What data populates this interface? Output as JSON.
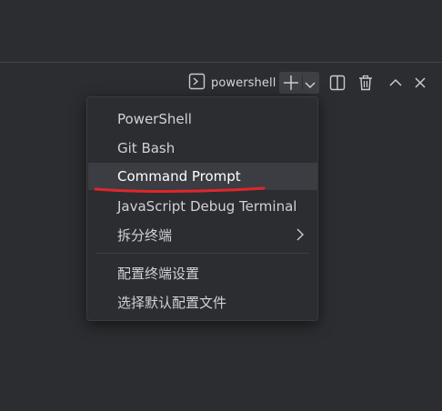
{
  "toolbar": {
    "terminal_label": "powershell",
    "icons": {
      "terminal": "terminal-icon",
      "new": "plus-icon",
      "dropdown": "chevron-down-icon",
      "split": "split-editor-icon",
      "trash": "trash-icon",
      "maximize": "chevron-up-icon",
      "close": "close-icon"
    }
  },
  "menu": {
    "items": [
      {
        "label": "PowerShell"
      },
      {
        "label": "Git Bash"
      },
      {
        "label": "Command Prompt",
        "selected": true
      },
      {
        "label": "JavaScript Debug Terminal"
      },
      {
        "label": "拆分终端",
        "has_submenu": true
      },
      {
        "label": "配置终端设置"
      },
      {
        "label": "选择默认配置文件"
      }
    ]
  },
  "annotation": {
    "color": "#e0262b"
  },
  "colors": {
    "background": "#2b2d30",
    "menu_selected": "#3b3d42",
    "text": "#d0d2d6"
  }
}
